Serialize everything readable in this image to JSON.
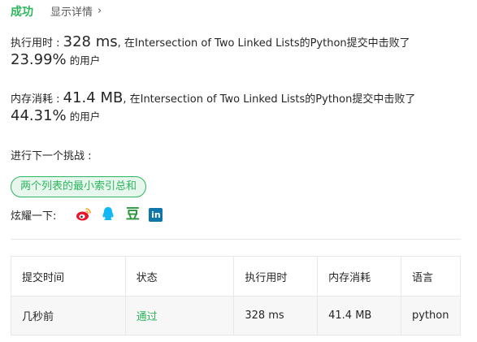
{
  "header": {
    "status": "成功",
    "details_link": "显示详情",
    "chevron": "›"
  },
  "runtime": {
    "label": "执行用时 :",
    "value": "328 ms",
    "sentence": ", 在Intersection of Two Linked Lists的Python提交中击败了",
    "percent": "23.99%",
    "suffix": "的用户"
  },
  "memory": {
    "label": "内存消耗 :",
    "value": "41.4 MB",
    "sentence": ", 在Intersection of Two Linked Lists的Python提交中击败了",
    "percent": "44.31%",
    "suffix": "的用户"
  },
  "next_challenge": {
    "label": "进行下一个挑战 :",
    "problem": "两个列表的最小索引总和"
  },
  "share": {
    "label": "炫耀一下:",
    "icons": [
      "weibo-icon",
      "qq-icon",
      "douban-icon",
      "linkedin-icon"
    ],
    "douban_glyph": "豆",
    "linkedin_glyph": "in"
  },
  "table": {
    "headers": [
      "提交时间",
      "状态",
      "执行用时",
      "内存消耗",
      "语言"
    ],
    "rows": [
      {
        "time": "几秒前",
        "status": "通过",
        "runtime": "328 ms",
        "memory": "41.4 MB",
        "language": "python"
      }
    ]
  },
  "colors": {
    "accent": "#2db55d",
    "weibo": "#e6162d",
    "qq": "#12b7f5",
    "douban": "#2e963d",
    "linkedin": "#0e76a8"
  }
}
